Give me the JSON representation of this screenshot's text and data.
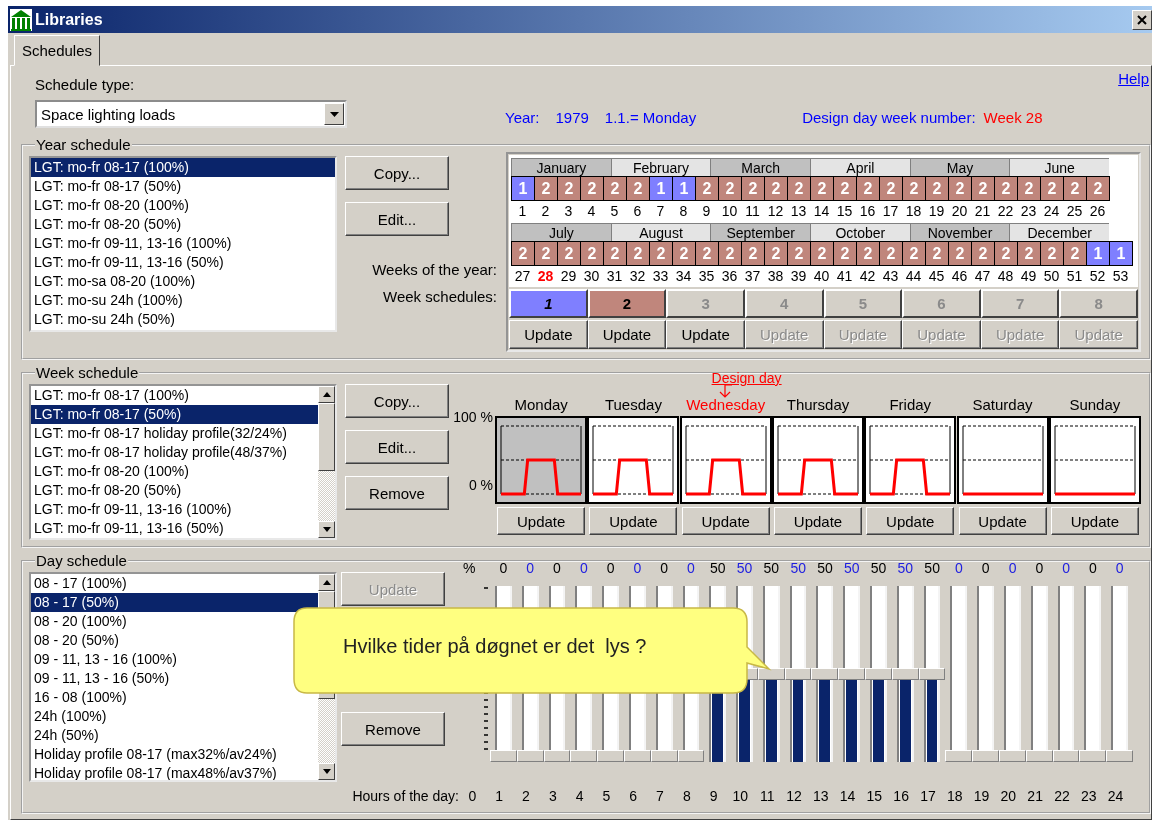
{
  "window": {
    "title": "Libraries"
  },
  "tabs": [
    {
      "label": "Schedules",
      "selected": true
    }
  ],
  "help_link": "Help",
  "schedule_type": {
    "label": "Schedule type:",
    "value": "Space lighting loads"
  },
  "info": {
    "year_label": "Year:",
    "year": "1979",
    "first_day": "1.1.= Monday",
    "design_week_label": "Design day week number:",
    "design_week": "Week 28"
  },
  "year_schedule": {
    "title": "Year schedule",
    "items": [
      {
        "label": "LGT: mo-fr 08-17 (100%)",
        "selected": true
      },
      {
        "label": "LGT: mo-fr 08-17 (50%)",
        "selected": false
      },
      {
        "label": "LGT: mo-fr 08-20 (100%)",
        "selected": false
      },
      {
        "label": "LGT: mo-fr 08-20 (50%)",
        "selected": false
      },
      {
        "label": "LGT: mo-fr 09-11, 13-16 (100%)",
        "selected": false
      },
      {
        "label": "LGT: mo-fr 09-11, 13-16 (50%)",
        "selected": false
      },
      {
        "label": "LGT: mo-sa 08-20 (100%)",
        "selected": false
      },
      {
        "label": "LGT: mo-su 24h (100%)",
        "selected": false
      },
      {
        "label": "LGT: mo-su 24h (50%)",
        "selected": false
      }
    ],
    "buttons": [
      {
        "label": "Copy...",
        "disabled": false
      },
      {
        "label": "Edit...",
        "disabled": false
      }
    ],
    "weeks_label": "Weeks of the year:",
    "week_schedules_label": "Week schedules:",
    "calendar_rows": [
      {
        "months": [
          "January",
          "February",
          "March",
          "April",
          "May",
          "June"
        ],
        "weeks": [
          {
            "number": "1",
            "schedule": "1",
            "color": "#7f7fff",
            "design": false
          },
          {
            "number": "2",
            "schedule": "2",
            "color": "#c0867c",
            "design": false
          },
          {
            "number": "3",
            "schedule": "2",
            "color": "#c0867c",
            "design": false
          },
          {
            "number": "4",
            "schedule": "2",
            "color": "#c0867c",
            "design": false
          },
          {
            "number": "5",
            "schedule": "2",
            "color": "#c0867c",
            "design": false
          },
          {
            "number": "6",
            "schedule": "2",
            "color": "#c0867c",
            "design": false
          },
          {
            "number": "7",
            "schedule": "1",
            "color": "#7f7fff",
            "design": false
          },
          {
            "number": "8",
            "schedule": "1",
            "color": "#7f7fff",
            "design": false
          },
          {
            "number": "9",
            "schedule": "2",
            "color": "#c0867c",
            "design": false
          },
          {
            "number": "10",
            "schedule": "2",
            "color": "#c0867c",
            "design": false
          },
          {
            "number": "11",
            "schedule": "2",
            "color": "#c0867c",
            "design": false
          },
          {
            "number": "12",
            "schedule": "2",
            "color": "#c0867c",
            "design": false
          },
          {
            "number": "13",
            "schedule": "2",
            "color": "#c0867c",
            "design": false
          },
          {
            "number": "14",
            "schedule": "2",
            "color": "#c0867c",
            "design": false
          },
          {
            "number": "15",
            "schedule": "2",
            "color": "#c0867c",
            "design": false
          },
          {
            "number": "16",
            "schedule": "2",
            "color": "#c0867c",
            "design": false
          },
          {
            "number": "17",
            "schedule": "2",
            "color": "#c0867c",
            "design": false
          },
          {
            "number": "18",
            "schedule": "2",
            "color": "#c0867c",
            "design": false
          },
          {
            "number": "19",
            "schedule": "2",
            "color": "#c0867c",
            "design": false
          },
          {
            "number": "20",
            "schedule": "2",
            "color": "#c0867c",
            "design": false
          },
          {
            "number": "21",
            "schedule": "2",
            "color": "#c0867c",
            "design": false
          },
          {
            "number": "22",
            "schedule": "2",
            "color": "#c0867c",
            "design": false
          },
          {
            "number": "23",
            "schedule": "2",
            "color": "#c0867c",
            "design": false
          },
          {
            "number": "24",
            "schedule": "2",
            "color": "#c0867c",
            "design": false
          },
          {
            "number": "25",
            "schedule": "2",
            "color": "#c0867c",
            "design": false
          },
          {
            "number": "26",
            "schedule": "2",
            "color": "#c0867c",
            "design": false
          }
        ]
      },
      {
        "months": [
          "July",
          "August",
          "September",
          "October",
          "November",
          "December"
        ],
        "weeks": [
          {
            "number": "27",
            "schedule": "2",
            "color": "#c0867c",
            "design": false
          },
          {
            "number": "28",
            "schedule": "2",
            "color": "#c0867c",
            "design": true
          },
          {
            "number": "29",
            "schedule": "2",
            "color": "#c0867c",
            "design": false
          },
          {
            "number": "30",
            "schedule": "2",
            "color": "#c0867c",
            "design": false
          },
          {
            "number": "31",
            "schedule": "2",
            "color": "#c0867c",
            "design": false
          },
          {
            "number": "32",
            "schedule": "2",
            "color": "#c0867c",
            "design": false
          },
          {
            "number": "33",
            "schedule": "2",
            "color": "#c0867c",
            "design": false
          },
          {
            "number": "34",
            "schedule": "2",
            "color": "#c0867c",
            "design": false
          },
          {
            "number": "35",
            "schedule": "2",
            "color": "#c0867c",
            "design": false
          },
          {
            "number": "36",
            "schedule": "2",
            "color": "#c0867c",
            "design": false
          },
          {
            "number": "37",
            "schedule": "2",
            "color": "#c0867c",
            "design": false
          },
          {
            "number": "38",
            "schedule": "2",
            "color": "#c0867c",
            "design": false
          },
          {
            "number": "39",
            "schedule": "2",
            "color": "#c0867c",
            "design": false
          },
          {
            "number": "40",
            "schedule": "2",
            "color": "#c0867c",
            "design": false
          },
          {
            "number": "41",
            "schedule": "2",
            "color": "#c0867c",
            "design": false
          },
          {
            "number": "42",
            "schedule": "2",
            "color": "#c0867c",
            "design": false
          },
          {
            "number": "43",
            "schedule": "2",
            "color": "#c0867c",
            "design": false
          },
          {
            "number": "44",
            "schedule": "2",
            "color": "#c0867c",
            "design": false
          },
          {
            "number": "45",
            "schedule": "2",
            "color": "#c0867c",
            "design": false
          },
          {
            "number": "46",
            "schedule": "2",
            "color": "#c0867c",
            "design": false
          },
          {
            "number": "47",
            "schedule": "2",
            "color": "#c0867c",
            "design": false
          },
          {
            "number": "48",
            "schedule": "2",
            "color": "#c0867c",
            "design": false
          },
          {
            "number": "49",
            "schedule": "2",
            "color": "#c0867c",
            "design": false
          },
          {
            "number": "50",
            "schedule": "2",
            "color": "#c0867c",
            "design": false
          },
          {
            "number": "51",
            "schedule": "2",
            "color": "#c0867c",
            "design": false
          },
          {
            "number": "52",
            "schedule": "1",
            "color": "#7f7fff",
            "design": false
          },
          {
            "number": "53",
            "schedule": "1",
            "color": "#7f7fff",
            "design": false
          }
        ]
      }
    ],
    "week_schedules": [
      {
        "label": "1",
        "color": "#7f7fff",
        "selected": true,
        "disabled": false
      },
      {
        "label": "2",
        "color": "#c0867c",
        "selected": false,
        "disabled": false
      },
      {
        "label": "3",
        "selected": false,
        "disabled": true
      },
      {
        "label": "4",
        "selected": false,
        "disabled": true
      },
      {
        "label": "5",
        "selected": false,
        "disabled": true
      },
      {
        "label": "6",
        "selected": false,
        "disabled": true
      },
      {
        "label": "7",
        "selected": false,
        "disabled": true
      },
      {
        "label": "8",
        "selected": false,
        "disabled": true
      }
    ],
    "update_buttons": [
      {
        "label": "Update",
        "disabled": false
      },
      {
        "label": "Update",
        "disabled": false
      },
      {
        "label": "Update",
        "disabled": false
      },
      {
        "label": "Update",
        "disabled": true
      },
      {
        "label": "Update",
        "disabled": true
      },
      {
        "label": "Update",
        "disabled": true
      },
      {
        "label": "Update",
        "disabled": true
      },
      {
        "label": "Update",
        "disabled": true
      }
    ]
  },
  "week_schedule": {
    "title": "Week schedule",
    "items": [
      {
        "label": "LGT: mo-fr 08-17 (100%)",
        "selected": false
      },
      {
        "label": "LGT: mo-fr 08-17 (50%)",
        "selected": true
      },
      {
        "label": "LGT: mo-fr 08-17 holiday profile(32/24%)",
        "selected": false
      },
      {
        "label": "LGT: mo-fr 08-17 holiday profile(48/37%)",
        "selected": false
      },
      {
        "label": "LGT: mo-fr 08-20 (100%)",
        "selected": false
      },
      {
        "label": "LGT: mo-fr 08-20 (50%)",
        "selected": false
      },
      {
        "label": "LGT: mo-fr 09-11, 13-16 (100%)",
        "selected": false
      },
      {
        "label": "LGT: mo-fr 09-11, 13-16 (50%)",
        "selected": false
      }
    ],
    "buttons": [
      {
        "label": "Copy...",
        "disabled": false
      },
      {
        "label": "Edit...",
        "disabled": false
      },
      {
        "label": "Remove",
        "disabled": false
      }
    ],
    "design_day_label": "Design day",
    "scale_labels": [
      "100 %",
      "0 %"
    ],
    "days": [
      {
        "name": "Monday",
        "selected": true,
        "design_day": false,
        "update": "Update",
        "kind": "step"
      },
      {
        "name": "Tuesday",
        "selected": false,
        "design_day": false,
        "update": "Update",
        "kind": "step"
      },
      {
        "name": "Wednesday",
        "selected": false,
        "design_day": true,
        "update": "Update",
        "kind": "step"
      },
      {
        "name": "Thursday",
        "selected": false,
        "design_day": false,
        "update": "Update",
        "kind": "step"
      },
      {
        "name": "Friday",
        "selected": false,
        "design_day": false,
        "update": "Update",
        "kind": "step"
      },
      {
        "name": "Saturday",
        "selected": false,
        "design_day": false,
        "update": "Update",
        "kind": "flat"
      },
      {
        "name": "Sunday",
        "selected": false,
        "design_day": false,
        "update": "Update",
        "kind": "flat"
      }
    ]
  },
  "day_schedule": {
    "title": "Day schedule",
    "items": [
      {
        "label": "08 - 17 (100%)",
        "selected": false
      },
      {
        "label": "08 - 17 (50%)",
        "selected": true
      },
      {
        "label": "08 - 20 (100%)",
        "selected": false
      },
      {
        "label": "08 - 20 (50%)",
        "selected": false
      },
      {
        "label": "09 - 11, 13 - 16 (100%)",
        "selected": false
      },
      {
        "label": "09 - 11, 13 - 16 (50%)",
        "selected": false
      },
      {
        "label": "16 - 08 (100%)",
        "selected": false
      },
      {
        "label": "24h (100%)",
        "selected": false
      },
      {
        "label": "24h (50%)",
        "selected": false
      },
      {
        "label": "Holiday profile 08-17 (max32%/av24%)",
        "selected": false
      },
      {
        "label": "Holiday profile 08-17 (max48%/av37%)",
        "selected": false
      }
    ],
    "buttons": [
      {
        "label": "Update",
        "disabled": true
      },
      {
        "label": "Remove",
        "disabled": false
      }
    ],
    "unit_label": "%",
    "hours_label": "Hours of the day:",
    "hour_ticks": [
      "0",
      "1",
      "2",
      "3",
      "4",
      "5",
      "6",
      "7",
      "8",
      "9",
      "10",
      "11",
      "12",
      "13",
      "14",
      "15",
      "16",
      "17",
      "18",
      "19",
      "20",
      "21",
      "22",
      "23",
      "24"
    ],
    "hours": [
      {
        "reading": "0",
        "level": 0
      },
      {
        "reading": "0",
        "level": 0
      },
      {
        "reading": "0",
        "level": 0
      },
      {
        "reading": "0",
        "level": 0
      },
      {
        "reading": "0",
        "level": 0
      },
      {
        "reading": "0",
        "level": 0
      },
      {
        "reading": "0",
        "level": 0
      },
      {
        "reading": "0",
        "level": 0
      },
      {
        "reading": "50",
        "level": 0.5
      },
      {
        "reading": "50",
        "level": 0.5
      },
      {
        "reading": "50",
        "level": 0.5
      },
      {
        "reading": "50",
        "level": 0.5
      },
      {
        "reading": "50",
        "level": 0.5
      },
      {
        "reading": "50",
        "level": 0.5
      },
      {
        "reading": "50",
        "level": 0.5
      },
      {
        "reading": "50",
        "level": 0.5
      },
      {
        "reading": "50",
        "level": 0.5
      },
      {
        "reading": "0",
        "level": 0
      },
      {
        "reading": "0",
        "level": 0
      },
      {
        "reading": "0",
        "level": 0
      },
      {
        "reading": "0",
        "level": 0
      },
      {
        "reading": "0",
        "level": 0
      },
      {
        "reading": "0",
        "level": 0
      },
      {
        "reading": "0",
        "level": 0
      }
    ]
  },
  "callout": {
    "text": "Hvilke tider på døgnet er det  lys ?"
  }
}
